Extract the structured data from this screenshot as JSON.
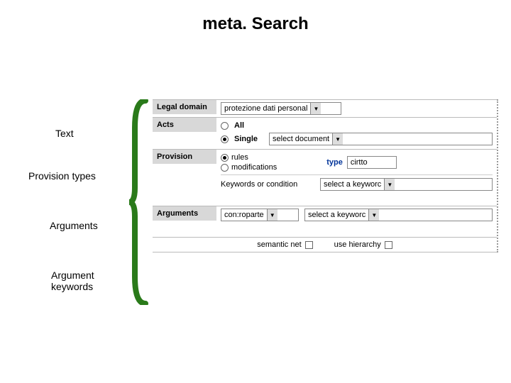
{
  "title": "meta. Search",
  "annotations": {
    "text": "Text",
    "provision_types": "Provision types",
    "arguments": "Arguments",
    "argument_keywords_l1": "Argument",
    "argument_keywords_l2": "keywords"
  },
  "form": {
    "legal_domain": {
      "label": "Legal domain",
      "value": "protezione dati personal"
    },
    "acts": {
      "label": "Acts",
      "all": "All",
      "single": "Single",
      "doc_select": "select document"
    },
    "provision": {
      "label": "Provision",
      "rules": "rules",
      "modifications": "modifications",
      "type_label": "type",
      "type_value": "cirtto",
      "keywords_label": "Keywords or condition",
      "keywords_value": "select a keyworc"
    },
    "arguments": {
      "label": "Arguments",
      "dropdown1": "con:roparte",
      "dropdown2": "select a keyworc"
    },
    "footer": {
      "semantic_net": "semantic net",
      "use_hierarchy": "use hierarchy"
    }
  }
}
